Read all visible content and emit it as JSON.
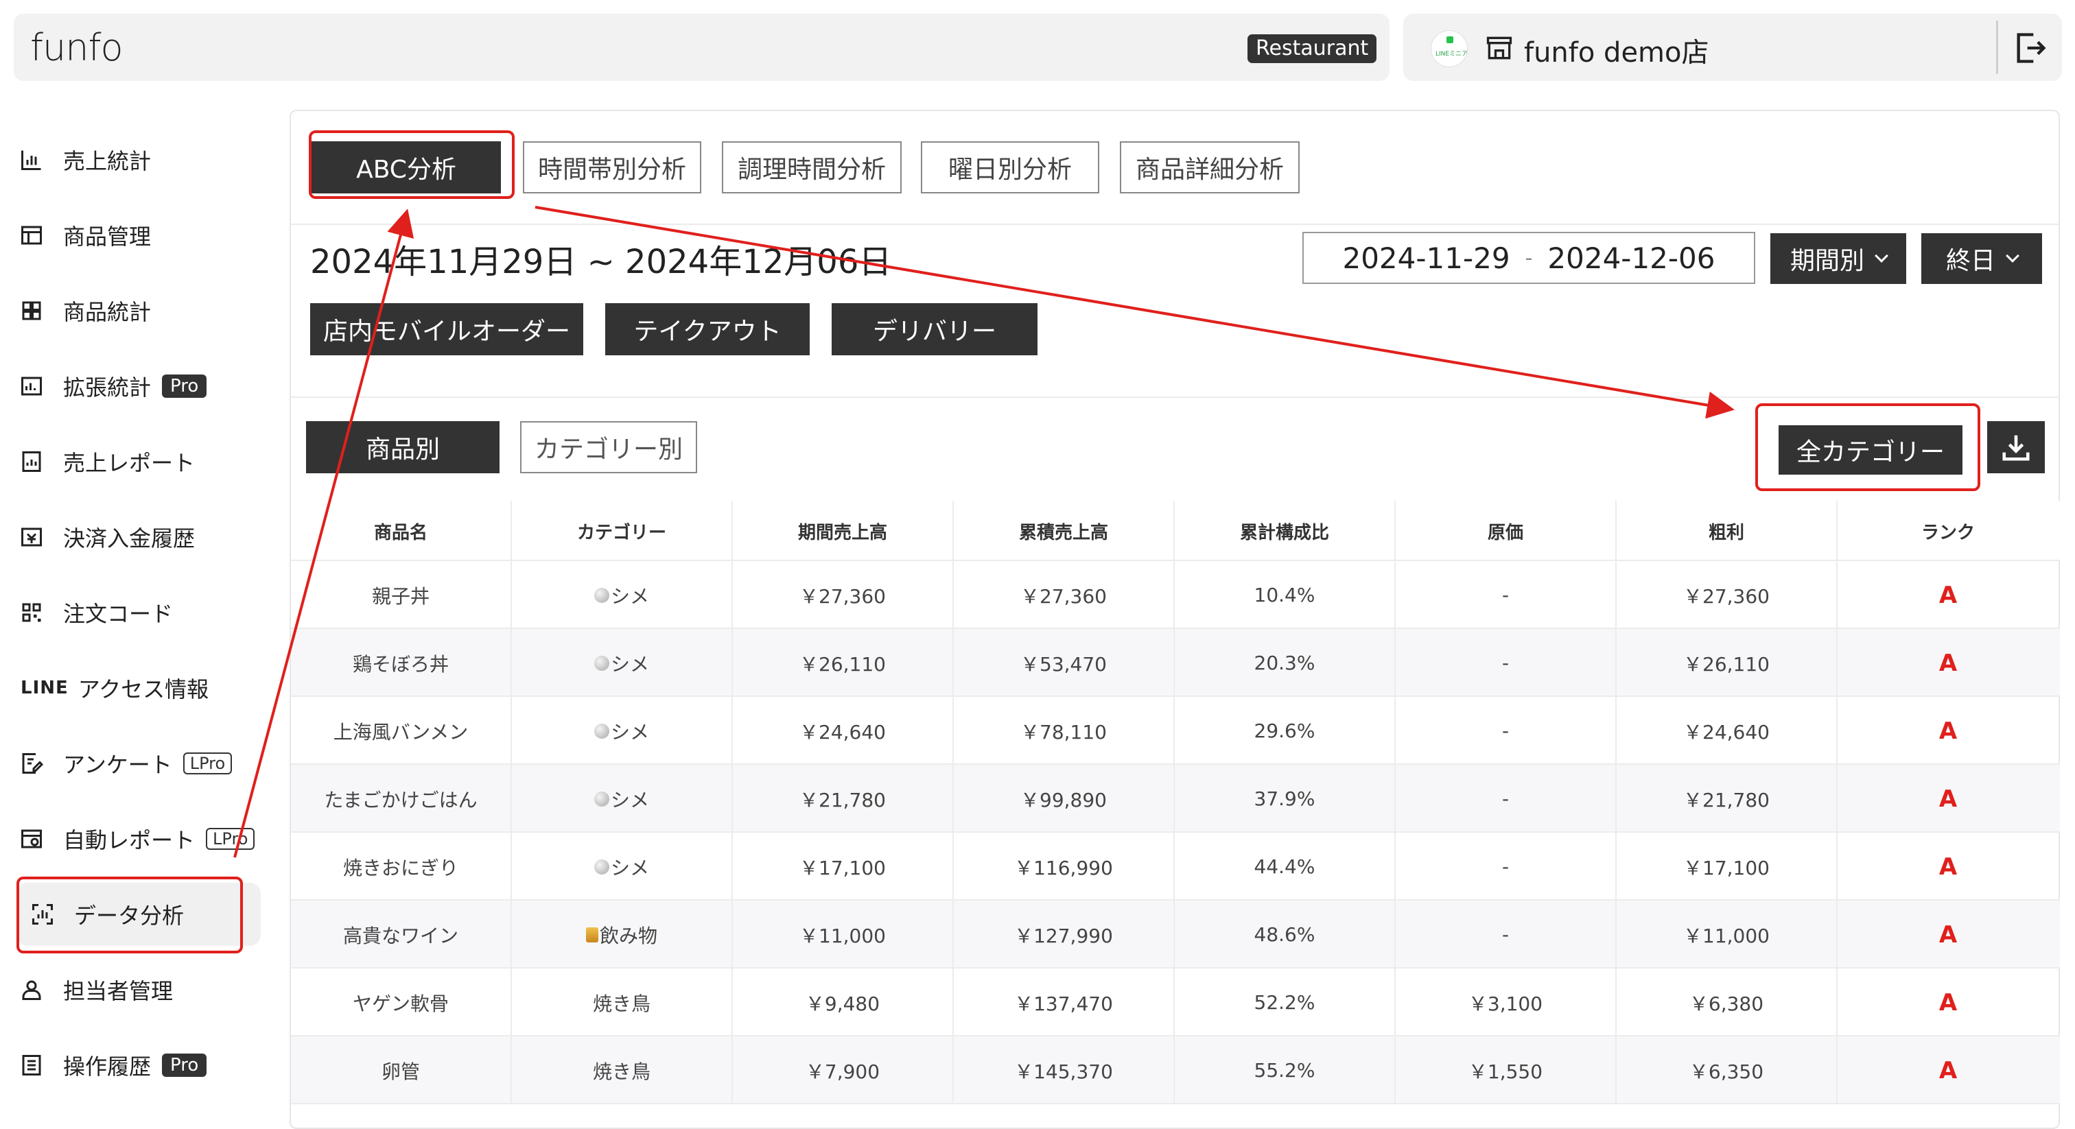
{
  "header": {
    "logo": "funfo",
    "badge": "Restaurant",
    "store_name": "funfo demo店",
    "store_logo_text": "LINEミニアプリ"
  },
  "sidebar": {
    "items": [
      {
        "label": "売上統計",
        "icon": "bar-chart-icon"
      },
      {
        "label": "商品管理",
        "icon": "product-grid-icon"
      },
      {
        "label": "商品統計",
        "icon": "grid-icon"
      },
      {
        "label": "拡張統計",
        "icon": "extended-chart-icon",
        "badge": "Pro"
      },
      {
        "label": "売上レポート",
        "icon": "report-icon"
      },
      {
        "label": "決済入金履歴",
        "icon": "payment-icon"
      },
      {
        "label": "注文コード",
        "icon": "qr-code-icon"
      },
      {
        "label": "アクセス情報",
        "prefix": "LINE",
        "icon": "line-icon"
      },
      {
        "label": "アンケート",
        "icon": "survey-icon",
        "badge": "LPro"
      },
      {
        "label": "自動レポート",
        "icon": "auto-report-icon",
        "badge": "LPro"
      },
      {
        "label": "データ分析",
        "icon": "data-analysis-icon",
        "active": true
      },
      {
        "label": "担当者管理",
        "icon": "staff-icon"
      },
      {
        "label": "操作履歴",
        "icon": "history-icon",
        "badge": "Pro"
      }
    ]
  },
  "main": {
    "tabs": [
      "ABC分析",
      "時間帯別分析",
      "調理時間分析",
      "曜日別分析",
      "商品詳細分析"
    ],
    "date_title": "2024年11月29日 ~ 2024年12月06日",
    "date_from": "2024-11-29",
    "date_sep": "-",
    "date_to": "2024-12-06",
    "period_select": "期間別",
    "time_select": "終日",
    "order_types": [
      "店内モバイルオーダー",
      "テイクアウト",
      "デリバリー"
    ],
    "view_modes": [
      "商品別",
      "カテゴリー別"
    ],
    "category_filter": "全カテゴリー",
    "table": {
      "columns": [
        "商品名",
        "カテゴリー",
        "期間売上高",
        "累積売上高",
        "累計構成比",
        "原価",
        "粗利",
        "ランク"
      ],
      "rows": [
        {
          "name": "親子丼",
          "category": "シメ",
          "cat_icon": "rice-icon",
          "period": "￥27,360",
          "cumulative": "￥27,360",
          "ratio": "10.4%",
          "cost": "-",
          "profit": "￥27,360",
          "rank": "A"
        },
        {
          "name": "鶏そぼろ丼",
          "category": "シメ",
          "cat_icon": "rice-icon",
          "period": "￥26,110",
          "cumulative": "￥53,470",
          "ratio": "20.3%",
          "cost": "-",
          "profit": "￥26,110",
          "rank": "A"
        },
        {
          "name": "上海風バンメン",
          "category": "シメ",
          "cat_icon": "rice-icon",
          "period": "￥24,640",
          "cumulative": "￥78,110",
          "ratio": "29.6%",
          "cost": "-",
          "profit": "￥24,640",
          "rank": "A"
        },
        {
          "name": "たまごかけごはん",
          "category": "シメ",
          "cat_icon": "rice-icon",
          "period": "￥21,780",
          "cumulative": "￥99,890",
          "ratio": "37.9%",
          "cost": "-",
          "profit": "￥21,780",
          "rank": "A"
        },
        {
          "name": "焼きおにぎり",
          "category": "シメ",
          "cat_icon": "rice-icon",
          "period": "￥17,100",
          "cumulative": "￥116,990",
          "ratio": "44.4%",
          "cost": "-",
          "profit": "￥17,100",
          "rank": "A"
        },
        {
          "name": "高貴なワイン",
          "category": "飲み物",
          "cat_icon": "drink-icon",
          "period": "￥11,000",
          "cumulative": "￥127,990",
          "ratio": "48.6%",
          "cost": "-",
          "profit": "￥11,000",
          "rank": "A"
        },
        {
          "name": "ヤゲン軟骨",
          "category": "焼き鳥",
          "cat_icon": "",
          "period": "￥9,480",
          "cumulative": "￥137,470",
          "ratio": "52.2%",
          "cost": "￥3,100",
          "profit": "￥6,380",
          "rank": "A"
        },
        {
          "name": "卵管",
          "category": "焼き鳥",
          "cat_icon": "",
          "period": "￥7,900",
          "cumulative": "￥145,370",
          "ratio": "55.2%",
          "cost": "￥1,550",
          "profit": "￥6,350",
          "rank": "A"
        }
      ]
    }
  },
  "colors": {
    "accent_dark": "#333333",
    "annotation_red": "#e0201c",
    "rank_red": "#e0201c"
  }
}
